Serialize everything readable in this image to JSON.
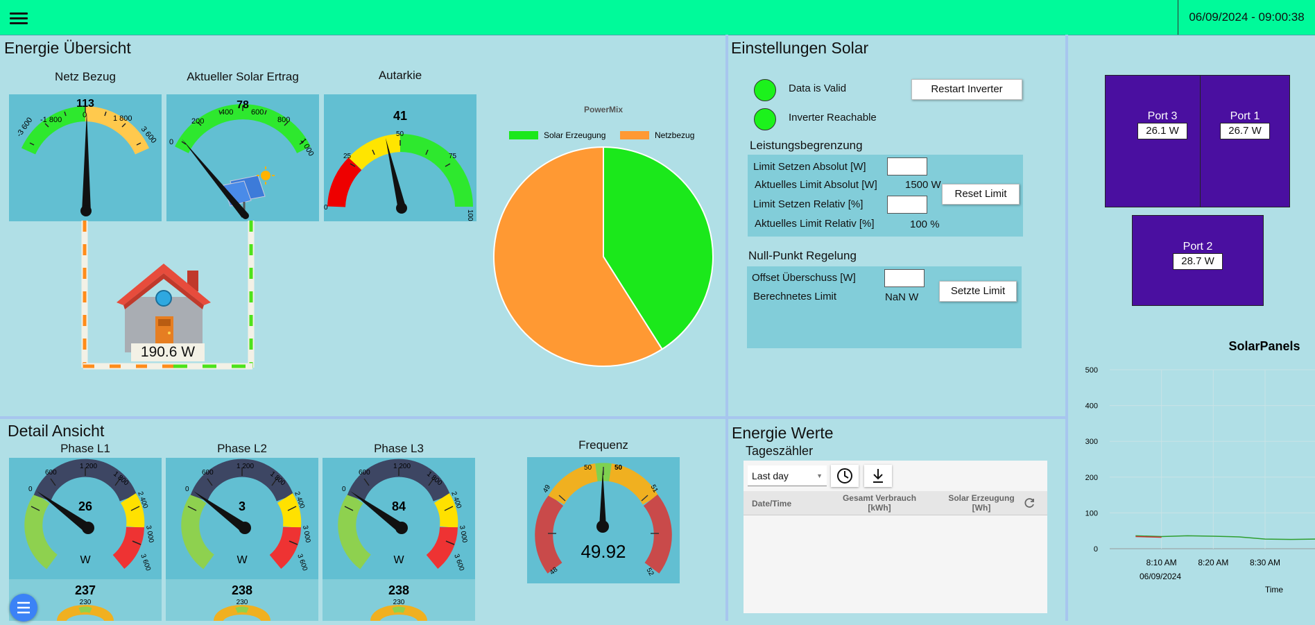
{
  "header": {
    "datetime": "06/09/2024 - 09:00:38"
  },
  "overview": {
    "title": "Energie Übersicht",
    "gauges": [
      {
        "title": "Netz Bezug",
        "value": "113",
        "ticks": [
          "-3 600",
          "-1 800",
          "0",
          "1 800",
          "3 600"
        ]
      },
      {
        "title": "Aktueller Solar Ertrag",
        "value": "78",
        "ticks": [
          "0",
          "200",
          "400",
          "600",
          "800",
          "1 000"
        ]
      },
      {
        "title": "Autarkie",
        "value": "41",
        "ticks": [
          "0",
          "25",
          "50",
          "75",
          "100"
        ]
      }
    ],
    "house_power": "190.6 W"
  },
  "powermix": {
    "title": "PowerMix",
    "legend": [
      "Solar Erzeugung",
      "Netzbezug"
    ],
    "colors": {
      "solar": "#1be81b",
      "grid": "#ff9933"
    }
  },
  "chart_data": [
    {
      "type": "pie",
      "title": "PowerMix",
      "categories": [
        "Solar Erzeugung",
        "Netzbezug"
      ],
      "values": [
        41,
        59
      ]
    },
    {
      "type": "line",
      "title": "SolarPanels",
      "xlabel": "Time",
      "x_ticks": [
        "8:10 AM",
        "8:20 AM",
        "8:30 AM"
      ],
      "x_sublabel": "06/09/2024",
      "y_ticks": [
        0,
        100,
        200,
        300,
        400,
        500
      ],
      "ylim": [
        0,
        500
      ],
      "series": [
        {
          "color": "#2e9e2e",
          "x": [
            "8:05",
            "8:10",
            "8:15",
            "8:20",
            "8:25",
            "8:30",
            "8:35",
            "8:40"
          ],
          "values": [
            36,
            34,
            36,
            35,
            33,
            27,
            26,
            27
          ]
        },
        {
          "color": "#cc3333",
          "x": [
            "8:05",
            "8:10"
          ],
          "values": [
            34,
            32
          ]
        }
      ]
    }
  ],
  "settings": {
    "title": "Einstellungen Solar",
    "status": [
      {
        "label": "Data is Valid",
        "color": "#1cf21c"
      },
      {
        "label": "Inverter Reachable",
        "color": "#1cf21c"
      }
    ],
    "restart_button": "Restart Inverter",
    "limit_section": {
      "title": "Leistungsbegrenzung",
      "set_absolute": "Limit Setzen Absolut [W]",
      "current_absolute": "Aktuelles Limit Absolut [W]",
      "current_absolute_value": "1500 W",
      "set_relative": "Limit Setzen Relativ [%]",
      "current_relative": "Aktuelles Limit Relativ [%]",
      "current_relative_value": "100 %",
      "reset_button": "Reset Limit"
    },
    "null_section": {
      "title": "Null-Punkt Regelung",
      "offset_label": "Offset Überschuss [W]",
      "calc_label": "Berechnetes Limit",
      "calc_value": "NaN W",
      "set_button": "Setzte Limit"
    }
  },
  "ports": [
    {
      "name": "Port 3",
      "value": "26.1 W"
    },
    {
      "name": "Port 1",
      "value": "26.7 W"
    },
    {
      "name": "Port 2",
      "value": "28.7 W"
    }
  ],
  "detail": {
    "title": "Detail Ansicht",
    "phases": [
      {
        "title": "Phase L1",
        "value": "26",
        "unit": "W",
        "voltage": "237",
        "voltage_center": "230"
      },
      {
        "title": "Phase L2",
        "value": "3",
        "unit": "W",
        "voltage": "238",
        "voltage_center": "230"
      },
      {
        "title": "Phase L3",
        "value": "84",
        "unit": "W",
        "voltage": "238",
        "voltage_center": "230"
      }
    ],
    "phase_ticks": [
      "0",
      "600",
      "1 200",
      "1 800",
      "2 400",
      "3 000",
      "3 600"
    ],
    "frequency": {
      "title": "Frequenz",
      "value": "49.92",
      "ticks": [
        "48",
        "49",
        "50",
        "50",
        "51",
        "52"
      ]
    }
  },
  "energy": {
    "title": "Energie Werte",
    "subtitle": "Tageszähler",
    "range_select": "Last day",
    "columns": [
      "Date/Time",
      "Gesamt Verbrauch [kWh]",
      "Solar Erzeugung [Wh]"
    ]
  }
}
